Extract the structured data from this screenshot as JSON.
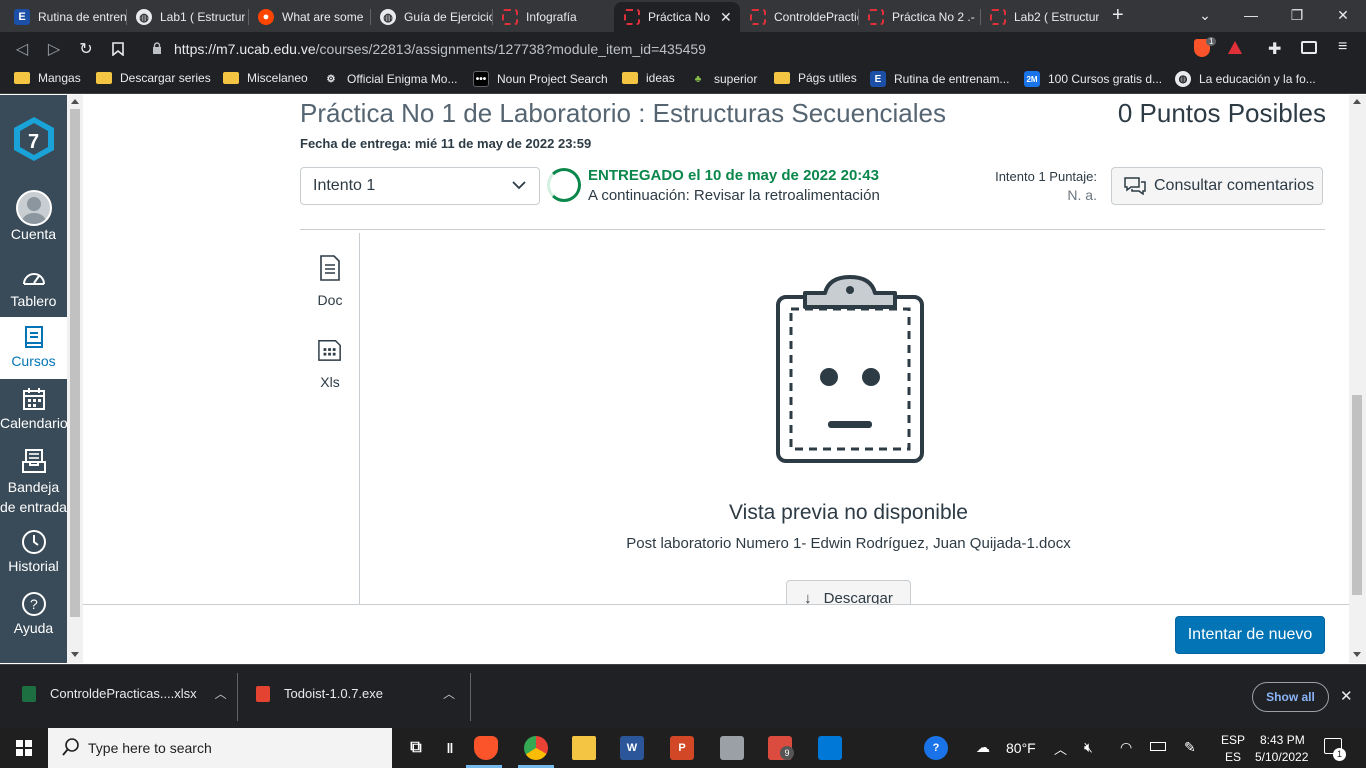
{
  "browser": {
    "tabs": [
      {
        "title": "Rutina de entren",
        "icon": "E"
      },
      {
        "title": "Lab1 ( Estructur",
        "icon": "globe"
      },
      {
        "title": "What are some",
        "icon": "reddit"
      },
      {
        "title": "Guía de Ejercicio",
        "icon": "globe"
      },
      {
        "title": "Infografía",
        "icon": "ring"
      },
      {
        "title": "Práctica No",
        "icon": "ring",
        "active": true
      },
      {
        "title": "ControldePractic",
        "icon": "ring"
      },
      {
        "title": "Práctica No 2 .-",
        "icon": "ring"
      },
      {
        "title": "Lab2 ( Estructur",
        "icon": "ring"
      }
    ],
    "new_tab": "+",
    "close_tab": "✕",
    "url_host": "https://m7.ucab.edu.ve",
    "url_path": "/courses/22813/assignments/127738?module_item_id=435459",
    "brave_badge": "1",
    "bookmarks": [
      {
        "label": "Mangas",
        "type": "folder"
      },
      {
        "label": "Descargar series",
        "type": "folder"
      },
      {
        "label": "Miscelaneo",
        "type": "folder"
      },
      {
        "label": "Official Enigma Mo...",
        "type": "site"
      },
      {
        "label": "Noun Project Search",
        "type": "site"
      },
      {
        "label": "ideas",
        "type": "folder"
      },
      {
        "label": "superior",
        "type": "site"
      },
      {
        "label": "Págs utiles",
        "type": "folder"
      },
      {
        "label": "Rutina de entrenam...",
        "type": "site"
      },
      {
        "label": "100 Cursos gratis d...",
        "type": "site"
      },
      {
        "label": "La educación y la fo...",
        "type": "site"
      }
    ]
  },
  "global_nav": {
    "logo": "7",
    "items": [
      {
        "label": "Cuenta"
      },
      {
        "label": "Tablero"
      },
      {
        "label": "Cursos"
      },
      {
        "label": "Calendario"
      },
      {
        "label": "Bandeja de entrada"
      },
      {
        "label": "Historial"
      },
      {
        "label": "Ayuda"
      }
    ]
  },
  "assignment": {
    "title": "Práctica No 1 de Laboratorio : Estructuras Secuenciales",
    "points": "0 Puntos Posibles",
    "due": "Fecha de entrega: mié 11 de may de 2022 23:59",
    "attempt_select": "Intento 1",
    "status_main": "ENTREGADO el 10 de may de 2022 20:43",
    "status_next": "A continuación: Revisar la retroalimentación",
    "score_label": "Intento 1 Puntaje:",
    "score_value": "N. a.",
    "comments_button": "Consultar comentarios",
    "files": [
      {
        "label": "Doc"
      },
      {
        "label": "Xls"
      }
    ],
    "preview_title": "Vista previa no disponible",
    "preview_file": "Post laboratorio Numero 1- Edwin Rodríguez, Juan Quijada-1.docx",
    "download_button": "Descargar",
    "retry_button": "Intentar de nuevo"
  },
  "downloads": {
    "items": [
      {
        "name": "ControldePracticas....xlsx"
      },
      {
        "name": "Todoist-1.0.7.exe"
      }
    ],
    "show_all": "Show all",
    "close": "✕"
  },
  "taskbar": {
    "search_placeholder": "Type here to search",
    "weather": "80°F",
    "lang_top": "ESP",
    "lang_bottom": "ES",
    "time": "8:43 PM",
    "date": "5/10/2022",
    "notif_count": "1",
    "app_badge": "9"
  },
  "colors": {
    "accent": "#0374b5",
    "success": "#0b874b",
    "nav_bg": "#394b58"
  }
}
